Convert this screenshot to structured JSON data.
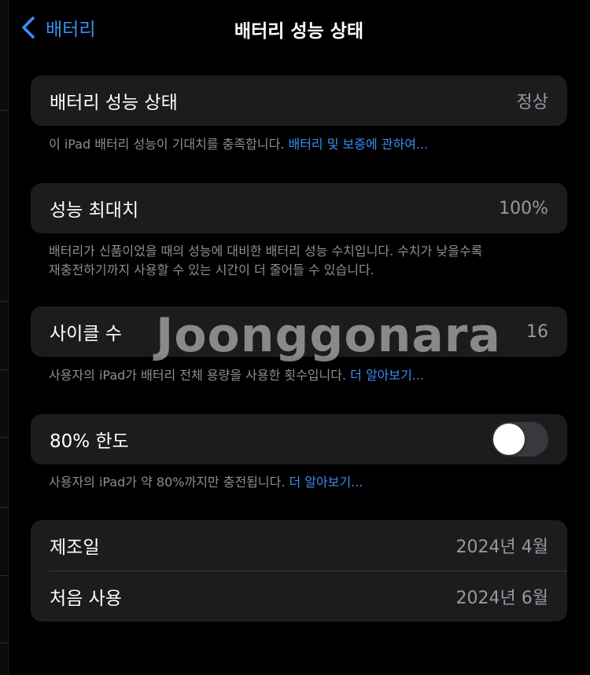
{
  "nav": {
    "back_label": "배터리",
    "title": "배터리 성능 상태"
  },
  "health": {
    "label": "배터리 성능 상태",
    "value": "정상",
    "footnote_text": "이 iPad 배터리 성능이 기대치를 충족합니다. ",
    "footnote_link": "배터리 및 보증에 관하여..."
  },
  "max_capacity": {
    "label": "성능 최대치",
    "value": "100%",
    "footnote_line1": "배터리가 신품이었을 때의 성능에 대비한 배터리 성능 수치입니다. 수치가 낮을수록",
    "footnote_line2": "재충전하기까지 사용할 수 있는 시간이 더 줄어들 수 있습니다."
  },
  "cycle_count": {
    "label": "사이클 수",
    "value": "16",
    "footnote_text": "사용자의 iPad가 배터리 전체 용량을 사용한 횟수입니다. ",
    "footnote_link": "더 알아보기..."
  },
  "limit_80": {
    "label": "80% 한도",
    "enabled": false,
    "footnote_text": "사용자의 iPad가 약 80%까지만 충전됩니다. ",
    "footnote_link": "더 알아보기..."
  },
  "dates": {
    "manufacture_label": "제조일",
    "manufacture_value": "2024년 4월",
    "first_use_label": "처음 사용",
    "first_use_value": "2024년 6월"
  },
  "watermark": "Joonggonara",
  "colors": {
    "background": "#000000",
    "cell": "#1c1c1e",
    "accent": "#3b8ef3",
    "secondary_text": "#8e8e93"
  }
}
